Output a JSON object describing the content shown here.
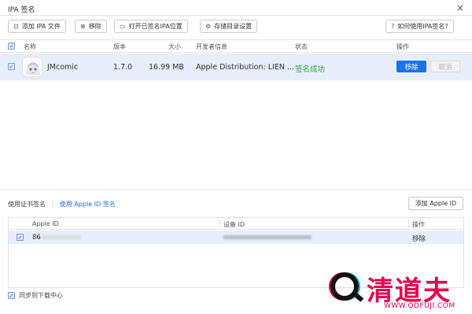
{
  "window": {
    "title": "IPA 签名",
    "close_icon": "×"
  },
  "toolbar": {
    "add_ipa": "添加 IPA 文件",
    "remove": "移除",
    "open_location": "打开已签名IPA位置",
    "storage_settings": "存储目录设置",
    "help": "如何使用IPA签名?"
  },
  "grid": {
    "headers": {
      "name": "名称",
      "version": "版本",
      "size": "大小",
      "developer": "开发者信息",
      "status": "状态",
      "actions": "操作"
    },
    "rows": [
      {
        "name": "JMcomic",
        "version": "1.7.0",
        "size": "16.99 MB",
        "developer": "Apple Distribution: LIEN ...",
        "status": "签名成功",
        "status_color": "#2aa33b",
        "remove": "移除",
        "cancel": "取消"
      }
    ]
  },
  "cert": {
    "tab_certificate": "使用证书签名",
    "tab_appleid": "使用 Apple ID 签名",
    "add_appleid": "添加 Apple ID",
    "headers": {
      "apple_id": "Apple ID",
      "device_id": "设备 ID",
      "actions": "操作"
    },
    "rows": [
      {
        "apple_id_prefix": "86",
        "remove": "移除"
      }
    ]
  },
  "footer": {
    "sync_label": "同步到下载中心"
  },
  "watermark": {
    "text": "清道夫",
    "url": "WWW.QDFUJI.COM",
    "color": "#e8004c"
  },
  "colors": {
    "accent": "#1a73e8",
    "row_selected": "#e7eefb",
    "success": "#2aa33b"
  }
}
